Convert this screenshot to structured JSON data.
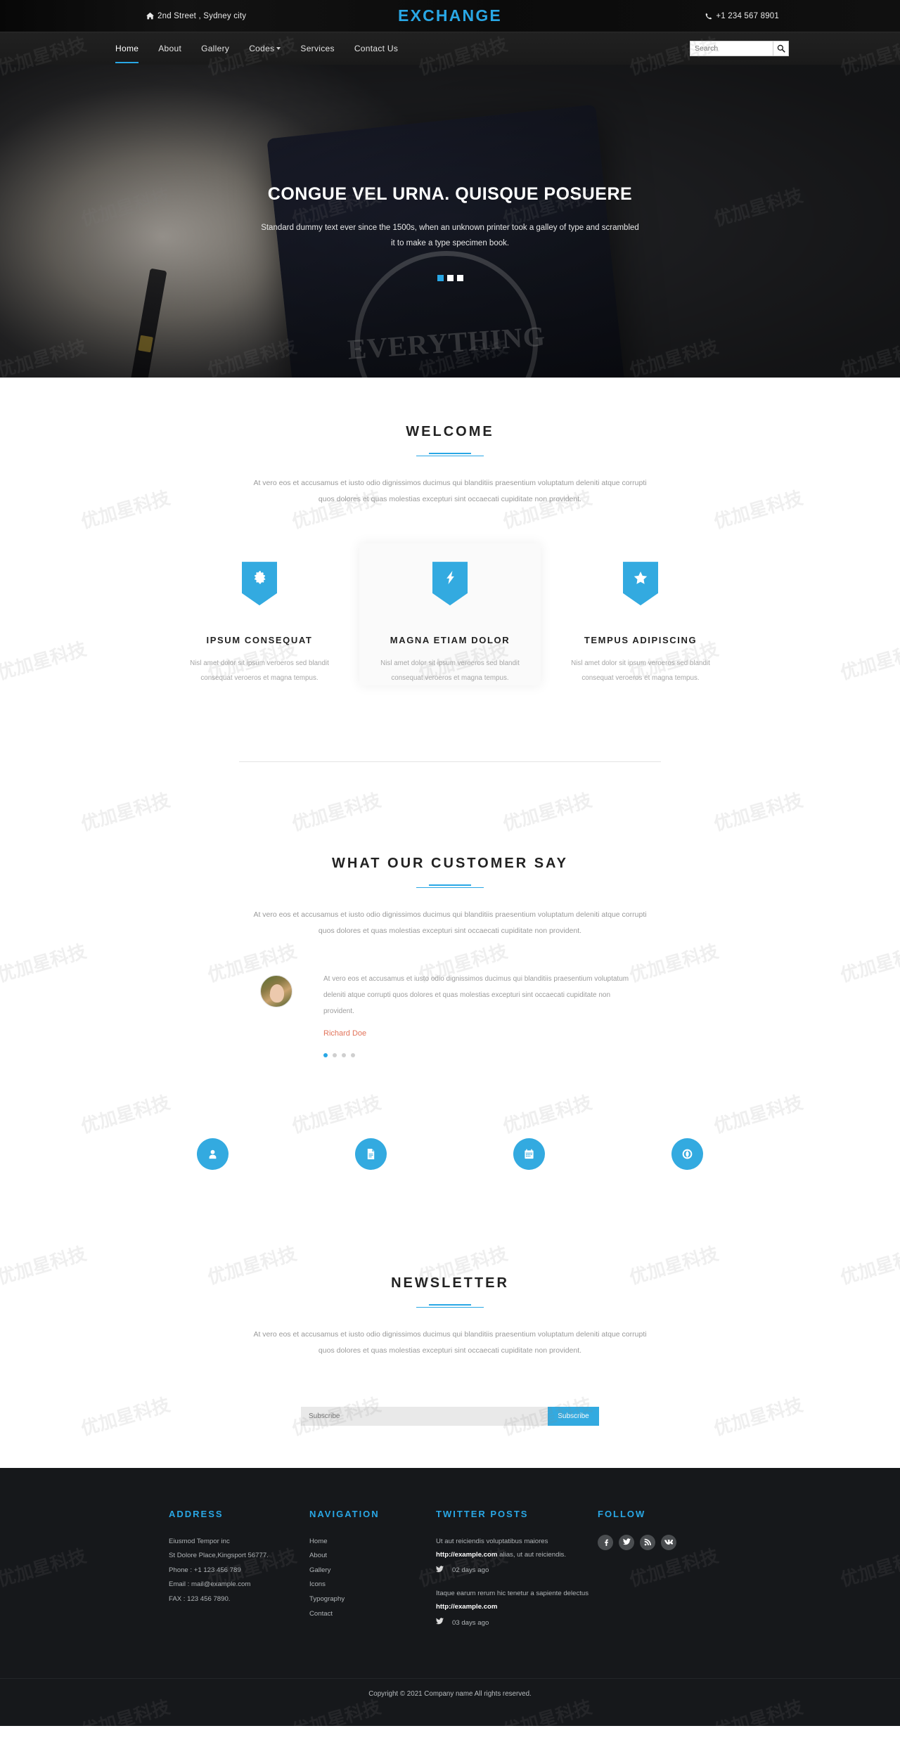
{
  "topbar": {
    "address": "2nd Street , Sydney city",
    "phone": "+1 234 567 8901",
    "brand": "EXCHANGE",
    "home_icon": "home-icon",
    "phone_icon": "phone-icon"
  },
  "nav": {
    "items": [
      {
        "label": "Home",
        "active": true
      },
      {
        "label": "About",
        "active": false
      },
      {
        "label": "Gallery",
        "active": false
      },
      {
        "label": "Codes",
        "active": false,
        "dropdown": true
      },
      {
        "label": "Services",
        "active": false
      },
      {
        "label": "Contact Us",
        "active": false
      }
    ],
    "search_placeholder": "Search",
    "search_value": "",
    "search_icon": "search-icon"
  },
  "hero": {
    "title": "CONGUE VEL URNA. QUISQUE POSUERE",
    "subtitle": "Standard dummy text ever since the 1500s, when an unknown printer took a galley of type and scrambled it to make a type specimen book.",
    "stamp_text": "EVERYTHING",
    "slides": 3,
    "active_slide": 0
  },
  "welcome": {
    "title": "WELCOME",
    "description": "At vero eos et accusamus et iusto odio dignissimos ducimus qui blanditiis praesentium voluptatum deleniti atque corrupti quos dolores et quas molestias excepturi sint occaecati cupiditate non provident.",
    "cards": [
      {
        "icon": "gear-icon",
        "title": "IPSUM CONSEQUAT",
        "text": "Nisl amet dolor sit ipsum veroeros sed blandit consequat veroeros et magna tempus."
      },
      {
        "icon": "bolt-icon",
        "title": "MAGNA ETIAM DOLOR",
        "text": "Nisl amet dolor sit ipsum veroeros sed blandit consequat veroeros et magna tempus."
      },
      {
        "icon": "star-icon",
        "title": "TEMPUS ADIPISCING",
        "text": "Nisl amet dolor sit ipsum veroeros sed blandit consequat veroeros et magna tempus."
      }
    ]
  },
  "testimonials": {
    "title": "WHAT OUR CUSTOMER SAY",
    "description": "At vero eos et accusamus et iusto odio dignissimos ducimus qui blanditiis praesentium voluptatum deleniti atque corrupti quos dolores et quas molestias excepturi sint occaecati cupiditate non provident.",
    "quote": "At vero eos et accusamus et iusto odio dignissimos ducimus qui blanditiis praesentium voluptatum deleniti atque corrupti quos dolores et quas molestias excepturi sint occaecati cupiditate non provident.",
    "author": "Richard Doe",
    "author_color": "#e2735a",
    "dots": 4,
    "active_dot": 0
  },
  "circle_icons": [
    {
      "icon": "user-icon"
    },
    {
      "icon": "document-icon"
    },
    {
      "icon": "calendar-icon"
    },
    {
      "icon": "lifebuoy-icon"
    }
  ],
  "newsletter": {
    "title": "NEWSLETTER",
    "description": "At vero eos et accusamus et iusto odio dignissimos ducimus qui blanditiis praesentium voluptatum deleniti atque corrupti quos dolores et quas molestias excepturi sint occaecati cupiditate non provident.",
    "input_placeholder": "Subscribe",
    "input_value": "",
    "button_label": "Subscribe"
  },
  "footer": {
    "address": {
      "title": "ADDRESS",
      "lines": [
        "Eiusmod Tempor inc",
        "St Dolore Place,Kingsport 56777.",
        "Phone : +1 123 456 789",
        "Email : mail@example.com",
        "FAX : 123 456 7890."
      ]
    },
    "navigation": {
      "title": "NAVIGATION",
      "links": [
        "Home",
        "About",
        "Gallery",
        "Icons",
        "Typography",
        "Contact"
      ]
    },
    "twitter": {
      "title": "TWITTER POSTS",
      "posts": [
        {
          "pre": "Ut aut reiciendis voluptatibus maiores ",
          "link": "http://example.com",
          "post": " alias, ut aut reiciendis.",
          "time": "02 days ago"
        },
        {
          "pre": "Itaque earum rerum hic tenetur a sapiente delectus ",
          "link": "http://example.com",
          "post": "",
          "time": "03 days ago"
        }
      ],
      "bird_icon": "twitter-icon"
    },
    "follow": {
      "title": "FOLLOW",
      "socials": [
        {
          "icon": "facebook-icon",
          "name": "Facebook"
        },
        {
          "icon": "twitter-icon",
          "name": "Twitter"
        },
        {
          "icon": "rss-icon",
          "name": "RSS"
        },
        {
          "icon": "vk-icon",
          "name": "VK"
        }
      ]
    },
    "copyright": "Copyright © 2021 Company name All rights reserved."
  },
  "theme": {
    "accent": "#29a7e5",
    "accent_light": "#33aae0",
    "dark": "#16181b",
    "topbar_bg": "#0d0d0d",
    "navbar_bg": "#1b1b1b"
  },
  "watermark": {
    "text": "优加星科技"
  }
}
